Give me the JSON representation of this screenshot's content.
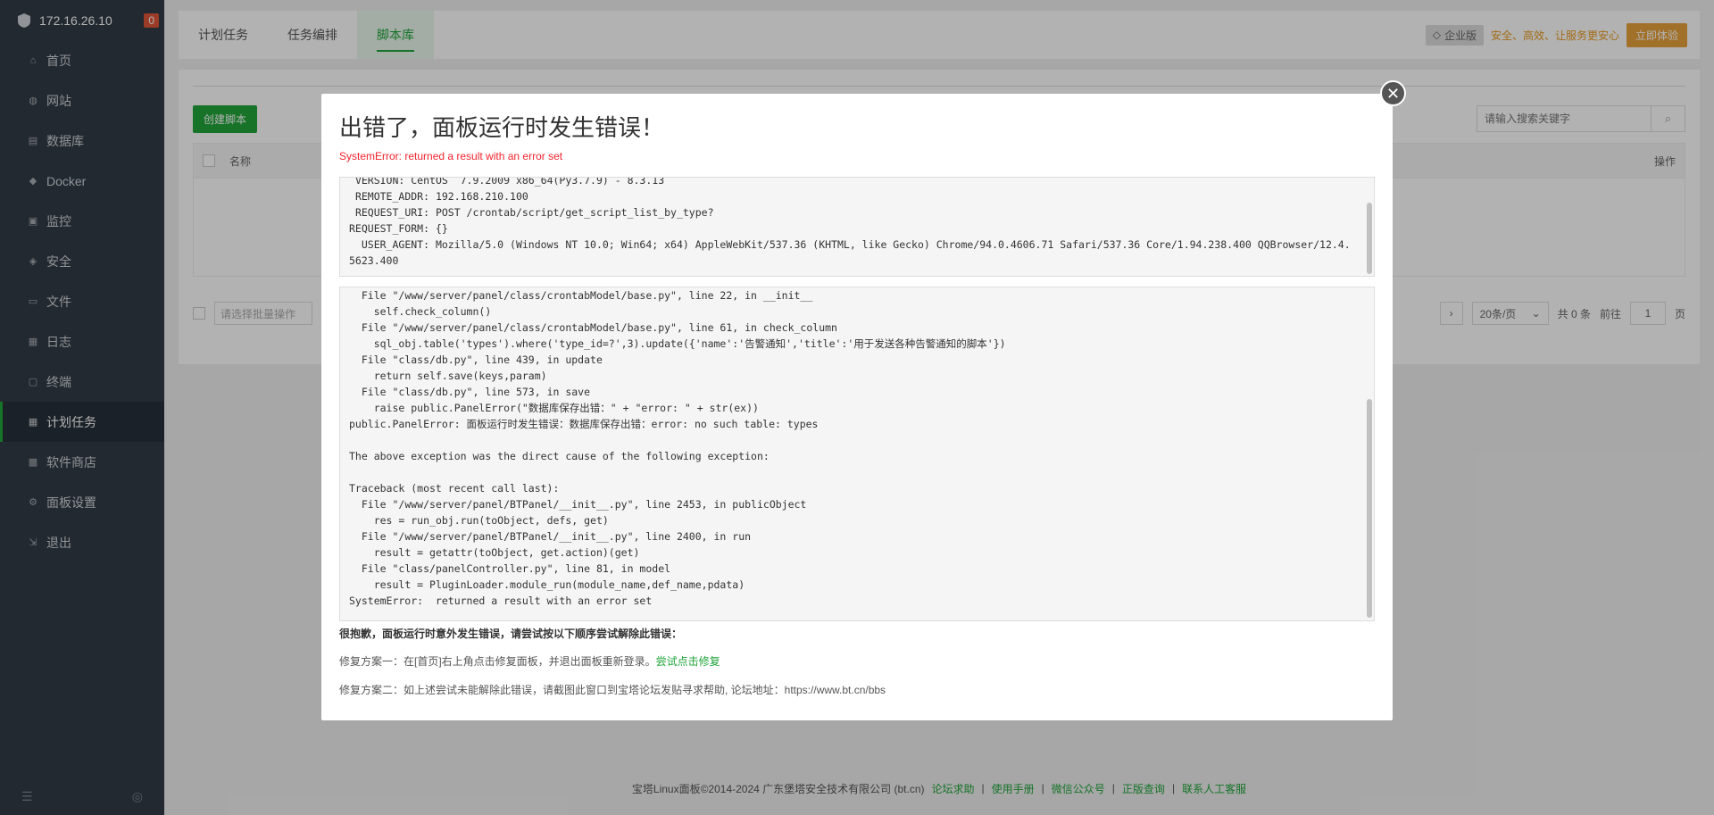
{
  "sidebar": {
    "ip": "172.16.26.10",
    "badge": "0",
    "items": [
      {
        "label": "首页",
        "icon": "home-icon"
      },
      {
        "label": "网站",
        "icon": "globe-icon"
      },
      {
        "label": "数据库",
        "icon": "database-icon"
      },
      {
        "label": "Docker",
        "icon": "docker-icon"
      },
      {
        "label": "监控",
        "icon": "monitor-icon"
      },
      {
        "label": "安全",
        "icon": "shield-icon"
      },
      {
        "label": "文件",
        "icon": "folder-icon"
      },
      {
        "label": "日志",
        "icon": "log-icon"
      },
      {
        "label": "终端",
        "icon": "terminal-icon"
      },
      {
        "label": "计划任务",
        "icon": "calendar-icon",
        "active": true
      },
      {
        "label": "软件商店",
        "icon": "store-icon"
      },
      {
        "label": "面板设置",
        "icon": "settings-icon"
      },
      {
        "label": "退出",
        "icon": "logout-icon"
      }
    ]
  },
  "tabs": [
    {
      "label": "计划任务"
    },
    {
      "label": "任务编排"
    },
    {
      "label": "脚本库",
      "active": true
    }
  ],
  "promo": {
    "enterprise": "企业版",
    "slogan": "安全、高效、让服务更安心",
    "try": "立即体验"
  },
  "toolbar": {
    "create": "创建脚本",
    "search_placeholder": "请输入搜索关键字"
  },
  "table": {
    "col_name": "名称",
    "col_op": "操作"
  },
  "bottom": {
    "batch_placeholder": "请选择批量操作",
    "page_size": "20条/页",
    "total": "共 0 条",
    "goto": "前往",
    "page": "1",
    "page_unit": "页"
  },
  "footer": {
    "copyright": "宝塔Linux面板©2014-2024 广东堡塔安全技术有限公司 (bt.cn)",
    "links": [
      "论坛求助",
      "使用手册",
      "微信公众号",
      "正版查询",
      "联系人工客服"
    ]
  },
  "modal": {
    "title": "出错了，面板运行时发生错误！",
    "subtitle": "SystemError: returned a result with an error set",
    "code_a": " VERSION: CentOS  7.9.2009 x86_64(Py3.7.9) - 8.3.13\n REMOTE_ADDR: 192.168.210.100\n REQUEST_URI: POST /crontab/script/get_script_list_by_type?\nREQUEST_FORM: {}\n  USER_AGENT: Mozilla/5.0 (Windows NT 10.0; Win64; x64) AppleWebKit/537.36 (KHTML, like Gecko) Chrome/94.0.4606.71 Safari/537.36 Core/1.94.238.400 QQBrowser/12.4.5623.400",
    "code_b": "  File \"/www/server/panel/class/crontabModel/base.py\", line 22, in __init__\n    self.check_column()\n  File \"/www/server/panel/class/crontabModel/base.py\", line 61, in check_column\n    sql_obj.table('types').where('type_id=?',3).update({'name':'告警通知','title':'用于发送各种告警通知的脚本'})\n  File \"class/db.py\", line 439, in update\n    return self.save(keys,param)\n  File \"class/db.py\", line 573, in save\n    raise public.PanelError(\"数据库保存出错：\" + \"error: \" + str(ex))\npublic.PanelError: 面板运行时发生错误：数据库保存出错：error: no such table: types\n\nThe above exception was the direct cause of the following exception:\n\nTraceback (most recent call last):\n  File \"/www/server/panel/BTPanel/__init__.py\", line 2453, in publicObject\n    res = run_obj.run(toObject, defs, get)\n  File \"/www/server/panel/BTPanel/__init__.py\", line 2400, in run\n    result = getattr(toObject, get.action)(get)\n  File \"class/panelController.py\", line 81, in model\n    result = PluginLoader.module_run(module_name,def_name,pdata)\nSystemError:  returned a result with an error set",
    "hint": "很抱歉，面板运行时意外发生错误，请尝试按以下顺序尝试解除此错误：",
    "fix1": "修复方案一：在[首页]右上角点击修复面板，并退出面板重新登录。",
    "fix1_link": "尝试点击修复",
    "fix2": "修复方案二：如上述尝试未能解除此错误，请截图此窗口到宝塔论坛发贴寻求帮助, 论坛地址：https://www.bt.cn/bbs"
  }
}
